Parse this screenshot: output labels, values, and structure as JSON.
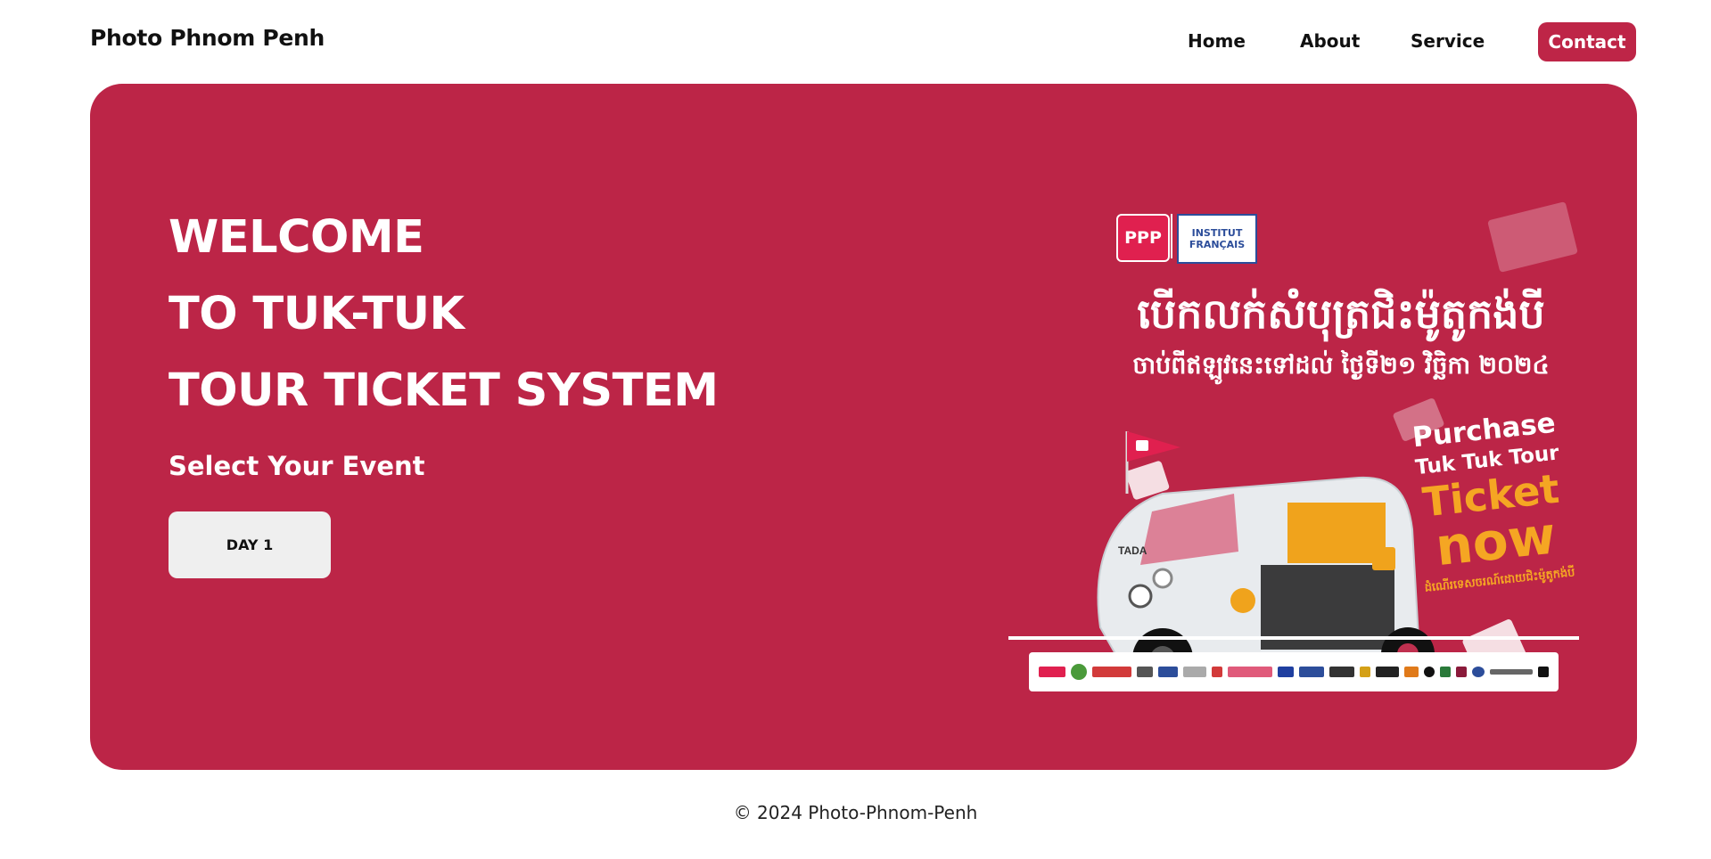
{
  "nav": {
    "brand": "Photo Phnom Penh",
    "links": [
      "Home",
      "About",
      "Service"
    ],
    "contact": "Contact"
  },
  "hero": {
    "title_lines": [
      "WELCOME",
      "TO TUK-TUK",
      "TOUR TICKET SYSTEM"
    ],
    "subtitle": "Select Your Event",
    "day_button": "DAY 1"
  },
  "poster": {
    "logo_ppp": "PPP",
    "logo_institut": [
      "INSTITUT",
      "FRANÇAIS"
    ],
    "khmer_title": "បើកលក់សំបុត្រជិះម៉ូតូកង់បី",
    "khmer_subtitle": "ចាប់ពីឥឡូវនេះទៅដល់ ថ្ងៃទី២១ វិច្ឆិកា ២០២៤",
    "purchase_line1": "Purchase",
    "purchase_line2": "Tuk Tuk Tour",
    "purchase_line3": "Ticket",
    "purchase_line4": "now",
    "khmer_note": "ដំណើរទេសចរណ៍ដោយជិះម៉ូតូកង់បី",
    "vehicle_brand": "TADA",
    "colors": {
      "hero_bg": "#bc2547",
      "accent": "#be2547",
      "ticket_orange": "#f5a623",
      "cabin_yellow": "#f0a31c"
    }
  },
  "footer": {
    "copyright": "© 2024 Photo-Phnom-Penh"
  }
}
